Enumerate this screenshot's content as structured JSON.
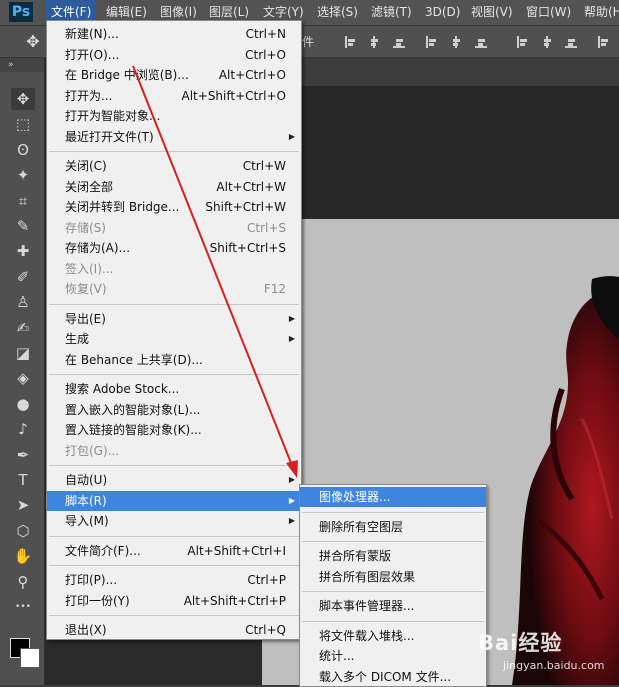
{
  "app": {
    "logo": "Ps"
  },
  "menubar": [
    {
      "label": "文件(F)",
      "active": true
    },
    {
      "label": "编辑(E)"
    },
    {
      "label": "图像(I)"
    },
    {
      "label": "图层(L)"
    },
    {
      "label": "文字(Y)"
    },
    {
      "label": "选择(S)"
    },
    {
      "label": "滤镜(T)"
    },
    {
      "label": "3D(D)"
    },
    {
      "label": "视图(V)"
    },
    {
      "label": "窗口(W)"
    },
    {
      "label": "帮助(H"
    }
  ],
  "options_bar": {
    "label": "件"
  },
  "tools": [
    {
      "icon": "move-icon",
      "glyph": "✥"
    },
    {
      "icon": "marquee-icon",
      "glyph": "⬚"
    },
    {
      "icon": "lasso-icon",
      "glyph": "ʘ"
    },
    {
      "icon": "magic-wand-icon",
      "glyph": "✦"
    },
    {
      "icon": "crop-icon",
      "glyph": "⌗"
    },
    {
      "icon": "eyedropper-icon",
      "glyph": "✎"
    },
    {
      "icon": "healing-brush-icon",
      "glyph": "✚"
    },
    {
      "icon": "brush-icon",
      "glyph": "✐"
    },
    {
      "icon": "stamp-icon",
      "glyph": "♙"
    },
    {
      "icon": "history-brush-icon",
      "glyph": "✍"
    },
    {
      "icon": "eraser-icon",
      "glyph": "◪"
    },
    {
      "icon": "paint-bucket-icon",
      "glyph": "◈"
    },
    {
      "icon": "blur-icon",
      "glyph": "●"
    },
    {
      "icon": "dodge-icon",
      "glyph": "♪"
    },
    {
      "icon": "pen-icon",
      "glyph": "✒"
    },
    {
      "icon": "type-icon",
      "glyph": "T"
    },
    {
      "icon": "path-select-icon",
      "glyph": "➤"
    },
    {
      "icon": "shape-icon",
      "glyph": "⬡"
    },
    {
      "icon": "hand-icon",
      "glyph": "✋"
    },
    {
      "icon": "zoom-icon",
      "glyph": "⚲"
    },
    {
      "icon": "more-tools-icon",
      "glyph": "•••"
    }
  ],
  "file_menu": {
    "groups": [
      [
        {
          "label": "新建(N)...",
          "shortcut": "Ctrl+N"
        },
        {
          "label": "打开(O)...",
          "shortcut": "Ctrl+O"
        },
        {
          "label": "在 Bridge 中浏览(B)...",
          "shortcut": "Alt+Ctrl+O"
        },
        {
          "label": "打开为...",
          "shortcut": "Alt+Shift+Ctrl+O"
        },
        {
          "label": "打开为智能对象...",
          "shortcut": ""
        },
        {
          "label": "最近打开文件(T)",
          "shortcut": "",
          "submenu": true
        }
      ],
      [
        {
          "label": "关闭(C)",
          "shortcut": "Ctrl+W"
        },
        {
          "label": "关闭全部",
          "shortcut": "Alt+Ctrl+W"
        },
        {
          "label": "关闭并转到 Bridge...",
          "shortcut": "Shift+Ctrl+W"
        },
        {
          "label": "存储(S)",
          "shortcut": "Ctrl+S",
          "disabled": true
        },
        {
          "label": "存储为(A)...",
          "shortcut": "Shift+Ctrl+S"
        },
        {
          "label": "签入(I)...",
          "shortcut": "",
          "disabled": true
        },
        {
          "label": "恢复(V)",
          "shortcut": "F12",
          "disabled": true
        }
      ],
      [
        {
          "label": "导出(E)",
          "shortcut": "",
          "submenu": true
        },
        {
          "label": "生成",
          "shortcut": "",
          "submenu": true
        },
        {
          "label": "在 Behance 上共享(D)...",
          "shortcut": ""
        }
      ],
      [
        {
          "label": "搜索 Adobe Stock...",
          "shortcut": ""
        },
        {
          "label": "置入嵌入的智能对象(L)...",
          "shortcut": ""
        },
        {
          "label": "置入链接的智能对象(K)...",
          "shortcut": ""
        },
        {
          "label": "打包(G)...",
          "shortcut": "",
          "disabled": true
        }
      ],
      [
        {
          "label": "自动(U)",
          "shortcut": "",
          "submenu": true
        },
        {
          "label": "脚本(R)",
          "shortcut": "",
          "submenu": true,
          "highlighted": true
        },
        {
          "label": "导入(M)",
          "shortcut": "",
          "submenu": true
        }
      ],
      [
        {
          "label": "文件简介(F)...",
          "shortcut": "Alt+Shift+Ctrl+I"
        }
      ],
      [
        {
          "label": "打印(P)...",
          "shortcut": "Ctrl+P"
        },
        {
          "label": "打印一份(Y)",
          "shortcut": "Alt+Shift+Ctrl+P"
        }
      ],
      [
        {
          "label": "退出(X)",
          "shortcut": "Ctrl+Q"
        }
      ]
    ]
  },
  "script_submenu": {
    "groups": [
      [
        {
          "label": "图像处理器...",
          "highlighted": true
        }
      ],
      [
        {
          "label": "删除所有空图层"
        }
      ],
      [
        {
          "label": "拼合所有蒙版"
        },
        {
          "label": "拼合所有图层效果"
        }
      ],
      [
        {
          "label": "脚本事件管理器..."
        }
      ],
      [
        {
          "label": "将文件载入堆栈..."
        },
        {
          "label": "统计..."
        },
        {
          "label": "载入多个 DICOM 文件..."
        }
      ]
    ]
  },
  "watermark": {
    "brand": "Bai经验",
    "url": "jingyan.baidu.com"
  },
  "colors": {
    "menu_highlight": "#3d86e0",
    "annotation_arrow": "#d81f1f",
    "photo_red": "#8e1219"
  }
}
